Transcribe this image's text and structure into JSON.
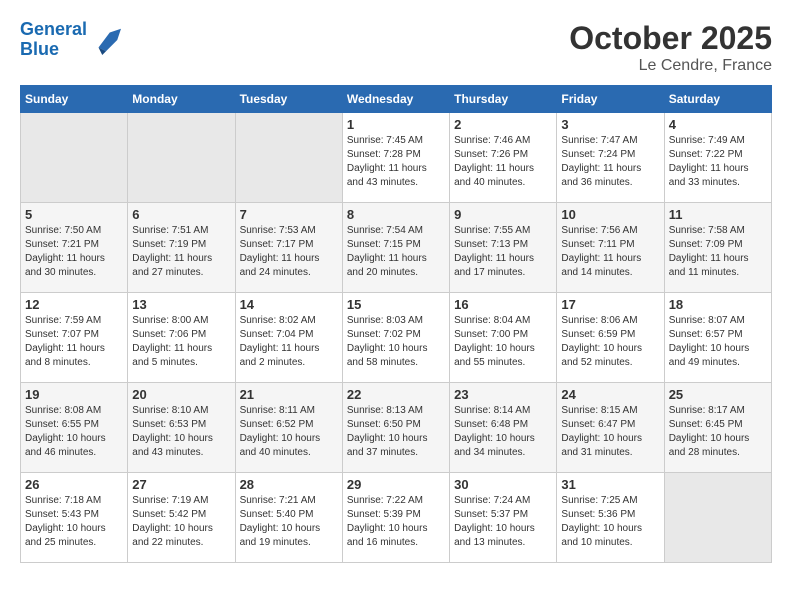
{
  "header": {
    "logo_line1": "General",
    "logo_line2": "Blue",
    "title": "October 2025",
    "subtitle": "Le Cendre, France"
  },
  "weekdays": [
    "Sunday",
    "Monday",
    "Tuesday",
    "Wednesday",
    "Thursday",
    "Friday",
    "Saturday"
  ],
  "weeks": [
    [
      {
        "day": "",
        "empty": true
      },
      {
        "day": "",
        "empty": true
      },
      {
        "day": "",
        "empty": true
      },
      {
        "day": "1",
        "sunrise": "7:45 AM",
        "sunset": "7:28 PM",
        "daylight": "11 hours and 43 minutes."
      },
      {
        "day": "2",
        "sunrise": "7:46 AM",
        "sunset": "7:26 PM",
        "daylight": "11 hours and 40 minutes."
      },
      {
        "day": "3",
        "sunrise": "7:47 AM",
        "sunset": "7:24 PM",
        "daylight": "11 hours and 36 minutes."
      },
      {
        "day": "4",
        "sunrise": "7:49 AM",
        "sunset": "7:22 PM",
        "daylight": "11 hours and 33 minutes."
      }
    ],
    [
      {
        "day": "5",
        "sunrise": "7:50 AM",
        "sunset": "7:21 PM",
        "daylight": "11 hours and 30 minutes."
      },
      {
        "day": "6",
        "sunrise": "7:51 AM",
        "sunset": "7:19 PM",
        "daylight": "11 hours and 27 minutes."
      },
      {
        "day": "7",
        "sunrise": "7:53 AM",
        "sunset": "7:17 PM",
        "daylight": "11 hours and 24 minutes."
      },
      {
        "day": "8",
        "sunrise": "7:54 AM",
        "sunset": "7:15 PM",
        "daylight": "11 hours and 20 minutes."
      },
      {
        "day": "9",
        "sunrise": "7:55 AM",
        "sunset": "7:13 PM",
        "daylight": "11 hours and 17 minutes."
      },
      {
        "day": "10",
        "sunrise": "7:56 AM",
        "sunset": "7:11 PM",
        "daylight": "11 hours and 14 minutes."
      },
      {
        "day": "11",
        "sunrise": "7:58 AM",
        "sunset": "7:09 PM",
        "daylight": "11 hours and 11 minutes."
      }
    ],
    [
      {
        "day": "12",
        "sunrise": "7:59 AM",
        "sunset": "7:07 PM",
        "daylight": "11 hours and 8 minutes."
      },
      {
        "day": "13",
        "sunrise": "8:00 AM",
        "sunset": "7:06 PM",
        "daylight": "11 hours and 5 minutes."
      },
      {
        "day": "14",
        "sunrise": "8:02 AM",
        "sunset": "7:04 PM",
        "daylight": "11 hours and 2 minutes."
      },
      {
        "day": "15",
        "sunrise": "8:03 AM",
        "sunset": "7:02 PM",
        "daylight": "10 hours and 58 minutes."
      },
      {
        "day": "16",
        "sunrise": "8:04 AM",
        "sunset": "7:00 PM",
        "daylight": "10 hours and 55 minutes."
      },
      {
        "day": "17",
        "sunrise": "8:06 AM",
        "sunset": "6:59 PM",
        "daylight": "10 hours and 52 minutes."
      },
      {
        "day": "18",
        "sunrise": "8:07 AM",
        "sunset": "6:57 PM",
        "daylight": "10 hours and 49 minutes."
      }
    ],
    [
      {
        "day": "19",
        "sunrise": "8:08 AM",
        "sunset": "6:55 PM",
        "daylight": "10 hours and 46 minutes."
      },
      {
        "day": "20",
        "sunrise": "8:10 AM",
        "sunset": "6:53 PM",
        "daylight": "10 hours and 43 minutes."
      },
      {
        "day": "21",
        "sunrise": "8:11 AM",
        "sunset": "6:52 PM",
        "daylight": "10 hours and 40 minutes."
      },
      {
        "day": "22",
        "sunrise": "8:13 AM",
        "sunset": "6:50 PM",
        "daylight": "10 hours and 37 minutes."
      },
      {
        "day": "23",
        "sunrise": "8:14 AM",
        "sunset": "6:48 PM",
        "daylight": "10 hours and 34 minutes."
      },
      {
        "day": "24",
        "sunrise": "8:15 AM",
        "sunset": "6:47 PM",
        "daylight": "10 hours and 31 minutes."
      },
      {
        "day": "25",
        "sunrise": "8:17 AM",
        "sunset": "6:45 PM",
        "daylight": "10 hours and 28 minutes."
      }
    ],
    [
      {
        "day": "26",
        "sunrise": "7:18 AM",
        "sunset": "5:43 PM",
        "daylight": "10 hours and 25 minutes."
      },
      {
        "day": "27",
        "sunrise": "7:19 AM",
        "sunset": "5:42 PM",
        "daylight": "10 hours and 22 minutes."
      },
      {
        "day": "28",
        "sunrise": "7:21 AM",
        "sunset": "5:40 PM",
        "daylight": "10 hours and 19 minutes."
      },
      {
        "day": "29",
        "sunrise": "7:22 AM",
        "sunset": "5:39 PM",
        "daylight": "10 hours and 16 minutes."
      },
      {
        "day": "30",
        "sunrise": "7:24 AM",
        "sunset": "5:37 PM",
        "daylight": "10 hours and 13 minutes."
      },
      {
        "day": "31",
        "sunrise": "7:25 AM",
        "sunset": "5:36 PM",
        "daylight": "10 hours and 10 minutes."
      },
      {
        "day": "",
        "empty": true
      }
    ]
  ],
  "labels": {
    "sunrise": "Sunrise:",
    "sunset": "Sunset:",
    "daylight": "Daylight:"
  }
}
